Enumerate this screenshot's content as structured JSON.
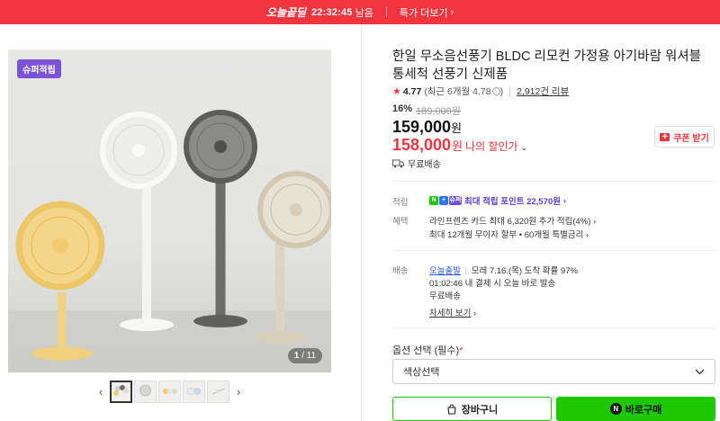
{
  "banner": {
    "brand": "오늘끝딜",
    "timer": "22:32:45",
    "timer_suffix": "남음",
    "more_label": "특가 더보기"
  },
  "gallery": {
    "badge": "슈퍼적립",
    "counter_current": "1",
    "counter_total": "/ 11"
  },
  "product": {
    "title": "한일 무소음선풍기 BLDC 리모컨 가정용 아기바람 워셔블 통세척 선풍기 신제품",
    "rating": "4.77",
    "rating_recent": "(최근 6개월 4.78",
    "rating_recent_close": ")",
    "review_count": "2,912건 리뷰",
    "discount_rate": "16%",
    "original_price": "189,000원",
    "price": "159,000",
    "price_unit": "원",
    "my_price": "158,000",
    "my_price_unit": "원",
    "my_price_label": "나의 할인가",
    "coupon_label": "쿠폰 받기",
    "shipping": "무료배송"
  },
  "benefits": {
    "points_label": "적립",
    "points_text": "최대 적립 포인트 22,570원",
    "badge_n": "N",
    "badge_plus": "+",
    "badge_super": "슈퍼",
    "benefit_label": "혜택",
    "benefit_line1": "라인프렌즈 카드 최대 6,320원 추가 적립(4%)",
    "benefit_line2": "최대 12개월 무이자 할부 • 60개월 특별금리"
  },
  "delivery": {
    "label": "배송",
    "today": "오늘출발",
    "eta": "모레 7.16.(목) 도착 확률 97%",
    "cutoff": "01:02:46  내 결제 시 오늘 바로 발송",
    "free": "무료배송",
    "details": "자세히 보기"
  },
  "options": {
    "label": "옵션 선택 (필수)",
    "required_mark": "*",
    "select_value": "색상선택"
  },
  "actions": {
    "cart": "장바구니",
    "buy": "바로구매",
    "buy_icon": "N"
  },
  "colors": {
    "accent_red": "#f0353f",
    "naver_green": "#1ec800",
    "super_purple": "#7b53d6"
  }
}
